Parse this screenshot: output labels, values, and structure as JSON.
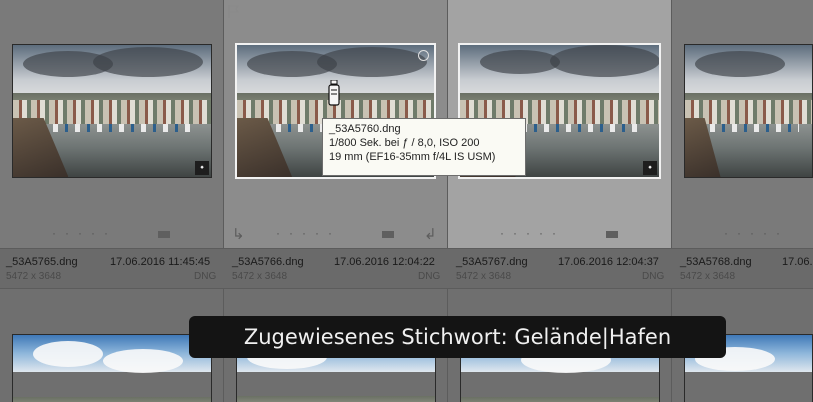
{
  "cells": [
    {
      "filename": "_53A5765.dng",
      "date": "17.06.2016 11:45:45",
      "dimensions": "5472 x 3648",
      "filetype": "DNG"
    },
    {
      "filename": "_53A5766.dng",
      "date": "17.06.2016 12:04:22",
      "dimensions": "5472 x 3648",
      "filetype": "DNG"
    },
    {
      "filename": "_53A5767.dng",
      "date": "17.06.2016 12:04:37",
      "dimensions": "5472 x 3648",
      "filetype": "DNG"
    },
    {
      "filename": "_53A5768.dng",
      "date": "17.06.",
      "dimensions": "5472 x 3648",
      "filetype": ""
    }
  ],
  "tooltip": {
    "line1": "_53A5760.dng",
    "line2": "1/800 Sek. bei ƒ / 8,0, ISO 200",
    "line3": "19 mm (EF16-35mm f/4L IS USM)"
  },
  "toast": {
    "text": "Zugewiesenes Stichwort: Gelände|Hafen"
  },
  "icons": {
    "keyword_badge": "tag-icon",
    "flag": "flag-icon",
    "rotate_left": "rotate-left-icon",
    "rotate_right": "rotate-right-icon",
    "painter": "painter-spray-can-icon",
    "quick_collection": "circle-icon"
  },
  "colors": {
    "grid_background": "#6f6f6f",
    "cell": "#7a7a7a",
    "cell_selected": "#a3a3a3",
    "toast_background": "#141414",
    "tooltip_background": "#fafaf4"
  }
}
